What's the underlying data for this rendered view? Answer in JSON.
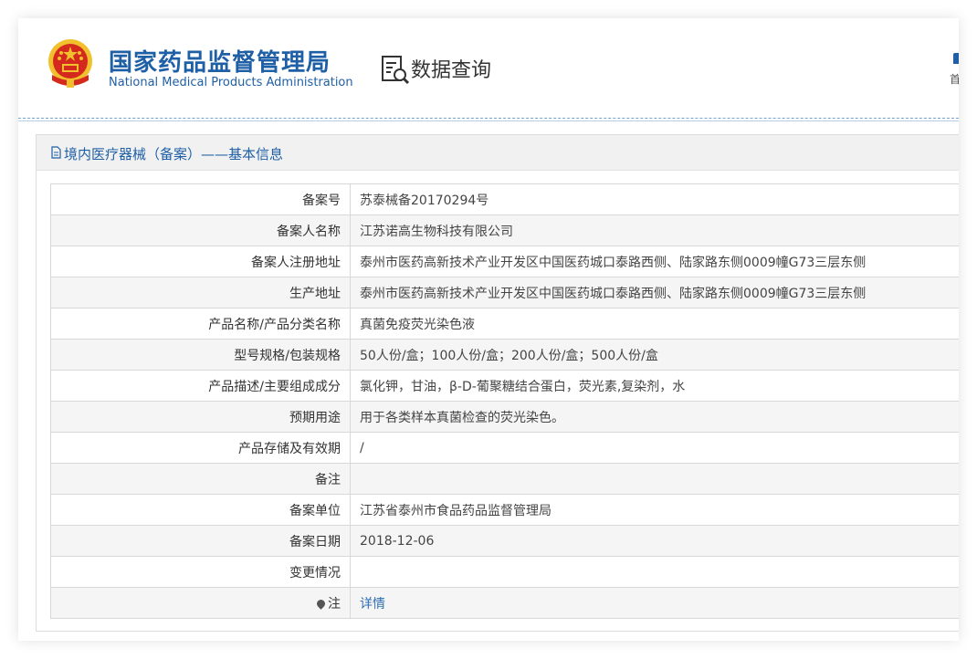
{
  "header": {
    "org_name_cn": "国家药品监督管理局",
    "org_name_en": "National Medical Products Administration",
    "query_title": "数据查询",
    "home_nav_label": "首"
  },
  "section": {
    "title": "境内医疗器械（备案）——基本信息"
  },
  "records": [
    {
      "label": "备案号",
      "value": "苏泰械备20170294号"
    },
    {
      "label": "备案人名称",
      "value": "江苏诺高生物科技有限公司"
    },
    {
      "label": "备案人注册地址",
      "value": "泰州市医药高新技术产业开发区中国医药城口泰路西侧、陆家路东侧0009幢G73三层东侧"
    },
    {
      "label": "生产地址",
      "value": "泰州市医药高新技术产业开发区中国医药城口泰路西侧、陆家路东侧0009幢G73三层东侧"
    },
    {
      "label": "产品名称/产品分类名称",
      "value": "真菌免疫荧光染色液"
    },
    {
      "label": "型号规格/包装规格",
      "value": "50人份/盒；100人份/盒；200人份/盒；500人份/盒"
    },
    {
      "label": "产品描述/主要组成成分",
      "value": "氯化钾，甘油，β-D-葡聚糖结合蛋白，荧光素,复染剂，水"
    },
    {
      "label": "预期用途",
      "value": "用于各类样本真菌检查的荧光染色。"
    },
    {
      "label": "产品存储及有效期",
      "value": "/"
    },
    {
      "label": "备注",
      "value": ""
    },
    {
      "label": "备案单位",
      "value": "江苏省泰州市食品药品监督管理局"
    },
    {
      "label": "备案日期",
      "value": "2018-12-06"
    },
    {
      "label": "变更情况",
      "value": ""
    },
    {
      "label": "注",
      "value": "详情"
    }
  ],
  "colors": {
    "brand_blue": "#1f5fa6",
    "link_blue": "#2e6db4",
    "emblem_red": "#d42a1e",
    "emblem_gold": "#f2c02c"
  },
  "icons": {
    "emblem": "national-emblem-icon",
    "query": "data-query-icon",
    "doc": "document-icon",
    "note": "pin-icon"
  }
}
